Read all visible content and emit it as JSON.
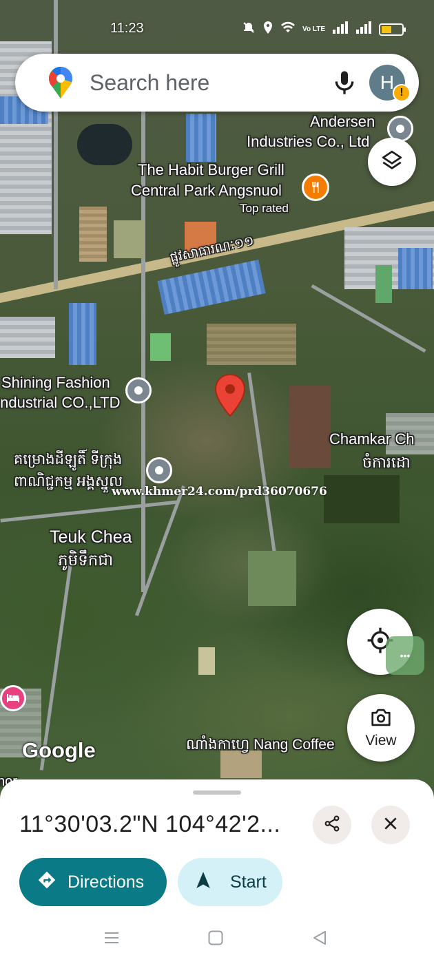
{
  "status_bar": {
    "time": "11:23",
    "network_label": "Vo LTE"
  },
  "search": {
    "placeholder": "Search here",
    "avatar_initial": "H",
    "alert_mark": "!"
  },
  "map": {
    "labels": {
      "andersen_line1": "Andersen",
      "andersen_line2": "Industries Co., Ltd",
      "habit_line1": "The Habit Burger Grill",
      "habit_line2": "Central Park Angsnuol",
      "habit_note": "Top rated",
      "road_name": "ផ្លូវសាធារណៈ១១",
      "shining_line1": "Shining Fashion",
      "shining_line2": "Industrial CO.,LTD",
      "khmer_project_line1": "គម្រោងដីឡូតិ៍ ទីក្រុង",
      "khmer_project_line2": "ពាណិជ្ជកម្ម អង្គស្នួល",
      "watermark": "www.khmer24.com/prd36070676",
      "chamkar_line1": "Chamkar Ch",
      "chamkar_line2": "ចំការដោ",
      "teuk_chea_line1": "Teuk Chea",
      "teuk_chea_line2": "ភូមិទឹកជា",
      "nang_coffee": "ណាំងកាហ្វេ Nang Coffee",
      "google_logo": "Google",
      "edge_fragment": "nor"
    }
  },
  "controls": {
    "view_label": "View",
    "bubble_dots": "•••"
  },
  "sheet": {
    "coordinates": "11°30'03.2\"N 104°42'2...",
    "directions_label": "Directions",
    "start_label": "Start"
  },
  "colors": {
    "primary_teal": "#0b7a87",
    "start_bg": "#d3f1f7",
    "pin_red": "#ea4335",
    "food_orange": "#f57c00",
    "hotel_pink": "#e8417f"
  },
  "icons": [
    "google-maps-pin-icon",
    "mic-icon",
    "layers-icon",
    "my-location-icon",
    "camera-search-icon",
    "share-icon",
    "close-icon",
    "directions-icon",
    "navigation-arrow-icon",
    "fork-knife-icon",
    "hotel-bed-icon",
    "mute-icon",
    "location-icon",
    "wifi-icon",
    "signal-icon",
    "battery-icon",
    "menu-nav-icon",
    "home-nav-icon",
    "back-nav-icon"
  ]
}
